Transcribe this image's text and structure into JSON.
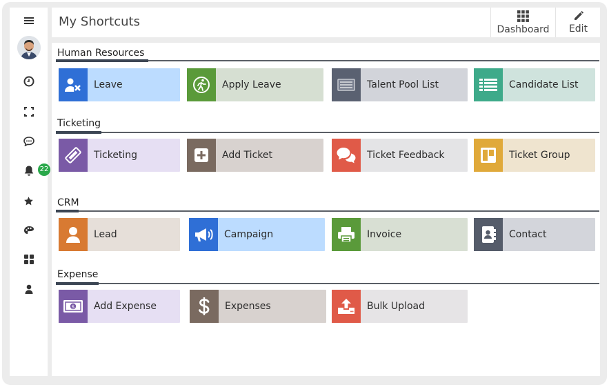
{
  "header": {
    "title": "My Shortcuts",
    "dashboard_label": "Dashboard",
    "edit_label": "Edit"
  },
  "sidebar": {
    "notification_count": "22"
  },
  "sections": [
    {
      "title": "Human Resources",
      "tiles": [
        {
          "label": "Leave",
          "icon": "user-remove-icon",
          "icon_color": "#2f6fd6",
          "bg_color": "#bcdcff"
        },
        {
          "label": "Apply Leave",
          "icon": "runner-icon",
          "icon_color": "#5a9a3a",
          "bg_color": "#d6dfd2"
        },
        {
          "label": "Talent Pool List",
          "icon": "list-card-icon",
          "icon_color": "#5a6171",
          "bg_color": "#d2d4da"
        },
        {
          "label": "Candidate List",
          "icon": "table-list-icon",
          "icon_color": "#3eaa8a",
          "bg_color": "#cfe3dd"
        }
      ]
    },
    {
      "title": "Ticketing",
      "tiles": [
        {
          "label": "Ticketing",
          "icon": "ticket-icon",
          "icon_color": "#7a5aa6",
          "bg_color": "#e6dff3"
        },
        {
          "label": "Add Ticket",
          "icon": "plus-square-icon",
          "icon_color": "#7a6a60",
          "bg_color": "#d8d2cf"
        },
        {
          "label": "Ticket Feedback",
          "icon": "chat-bubbles-icon",
          "icon_color": "#e05a48",
          "bg_color": "#e4e4e6"
        },
        {
          "label": "Ticket Group",
          "icon": "board-icon",
          "icon_color": "#e0a93a",
          "bg_color": "#efe4cf"
        }
      ]
    },
    {
      "title": "CRM",
      "tiles": [
        {
          "label": "Lead",
          "icon": "person-icon",
          "icon_color": "#d87a32",
          "bg_color": "#e6dfd9"
        },
        {
          "label": "Campaign",
          "icon": "megaphone-icon",
          "icon_color": "#2f6fd6",
          "bg_color": "#bcdcff"
        },
        {
          "label": "Invoice",
          "icon": "printer-icon",
          "icon_color": "#5a9a3a",
          "bg_color": "#d8dfd3"
        },
        {
          "label": "Contact",
          "icon": "address-book-icon",
          "icon_color": "#555c6a",
          "bg_color": "#d3d5db"
        }
      ]
    },
    {
      "title": "Expense",
      "tiles": [
        {
          "label": "Add Expense",
          "icon": "money-icon",
          "icon_color": "#7a5aa6",
          "bg_color": "#e6dff3"
        },
        {
          "label": "Expenses",
          "icon": "dollar-icon",
          "icon_color": "#7a6a60",
          "bg_color": "#d8d2cf"
        },
        {
          "label": "Bulk Upload",
          "icon": "upload-icon",
          "icon_color": "#e05a48",
          "bg_color": "#e6e4e6"
        }
      ]
    }
  ]
}
